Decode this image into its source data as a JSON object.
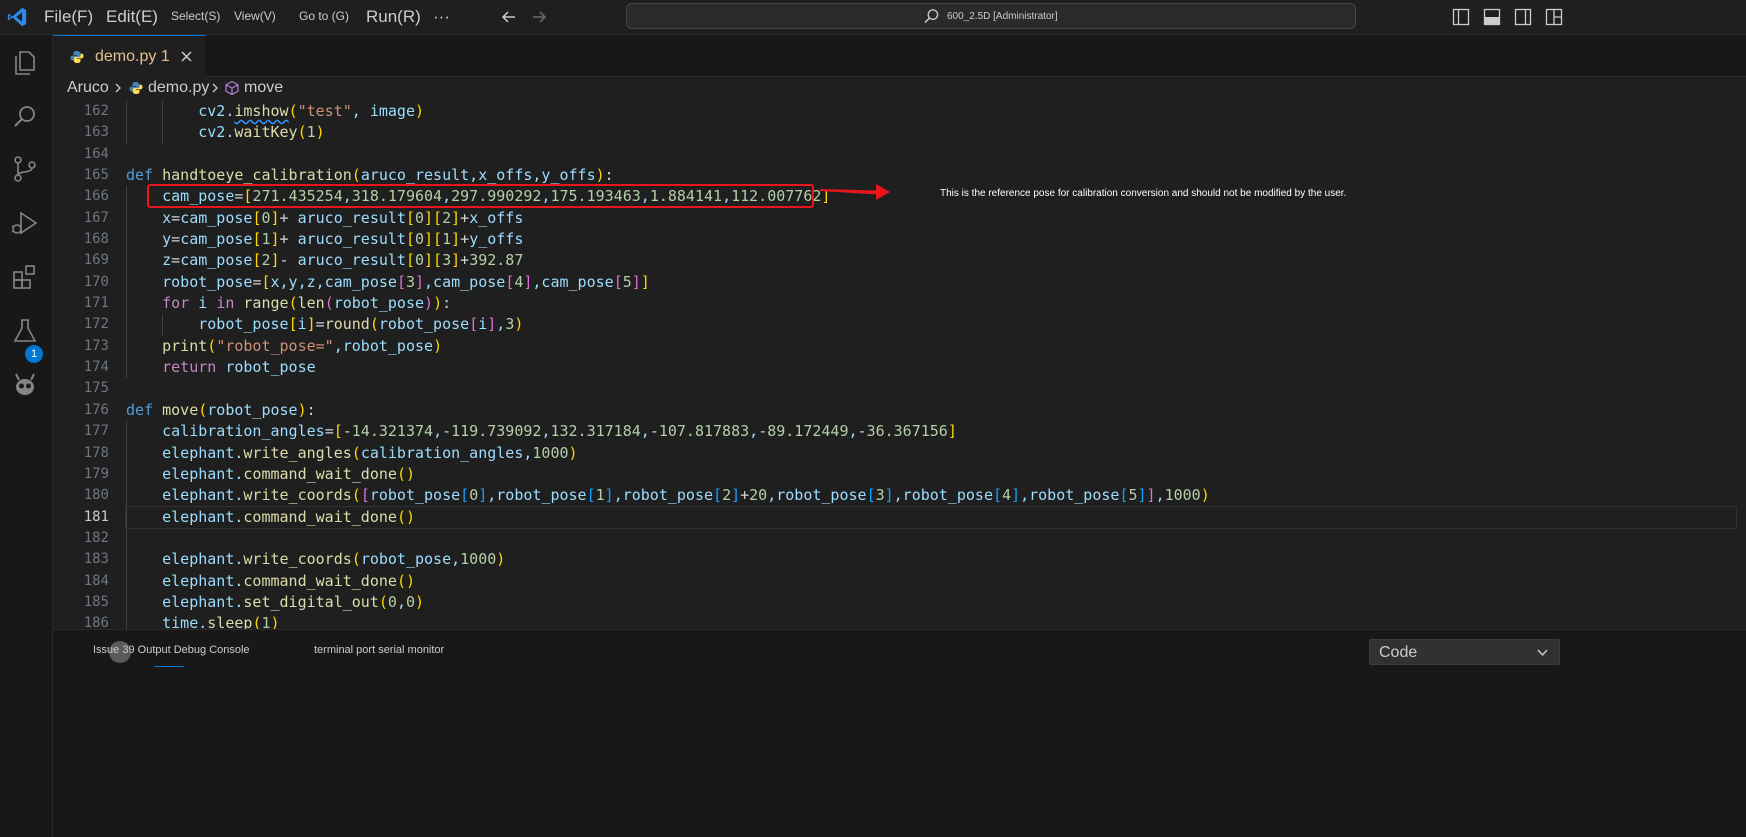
{
  "titlebar": {
    "menus": {
      "file": "File(F)",
      "edit": "Edit(E)",
      "select": "Select(S)",
      "view": "View(V)",
      "goto": "Go to (G)",
      "run": "Run(R)",
      "more": "···"
    },
    "command_center": "600_2.5D [Administrator]",
    "icons": [
      "vscode-logo-icon",
      "back-arrow-icon",
      "forward-arrow-icon",
      "search-icon",
      "toggle-primary-sidebar-icon",
      "toggle-panel-icon",
      "toggle-secondary-sidebar-icon",
      "customize-layout-icon"
    ]
  },
  "activitybar": {
    "icons": [
      "explorer-icon",
      "search-icon",
      "source-control-icon",
      "run-debug-icon",
      "extensions-icon",
      "testing-icon",
      "platformio-alien-icon"
    ],
    "extensions_badge": "1"
  },
  "tabs": [
    {
      "label": "demo.py 1",
      "icon": "python-icon",
      "active": true,
      "modified_color": "#e2c08d"
    }
  ],
  "breadcrumb": {
    "folder": "Aruco",
    "file": "demo.py",
    "symbol": "move"
  },
  "editor": {
    "current_line": "181",
    "line_numbers": [
      "162",
      "163",
      "164",
      "165",
      "166",
      "167",
      "168",
      "169",
      "170",
      "171",
      "172",
      "173",
      "174",
      "175",
      "176",
      "177",
      "178",
      "179",
      "180",
      "181",
      "182",
      "183",
      "184",
      "185",
      "186"
    ]
  },
  "annotation": {
    "note": "This is the reference pose for calibration conversion and should not be modified by the user.",
    "box_color": "#e8151b"
  },
  "panel": {
    "tab_issues": "Issue 39 Output Debug Console",
    "tab_terminal": "terminal port serial monitor",
    "select_value": "Code"
  },
  "colors": {
    "accent": "#0078d4",
    "editor_bg": "#1f1f1f",
    "sidebar_bg": "#181818"
  }
}
